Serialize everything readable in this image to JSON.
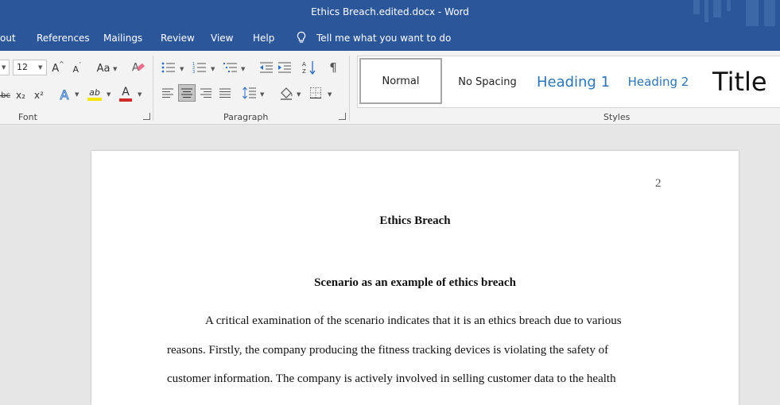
{
  "window": {
    "title": "Ethics Breach.edited.docx  -  Word"
  },
  "tabs": [
    {
      "label": "out"
    },
    {
      "label": "References"
    },
    {
      "label": "Mailings"
    },
    {
      "label": "Review"
    },
    {
      "label": "View"
    },
    {
      "label": "Help"
    }
  ],
  "tell_me": {
    "label": "Tell me what you want to do"
  },
  "font_group": {
    "label": "Font",
    "font_size": "12",
    "change_case": "Aa",
    "subscript": "x₂",
    "superscript": "x²",
    "strike": "abc",
    "grow": "A",
    "shrink": "A",
    "effects": "A",
    "highlight": "ab",
    "font_color": "A",
    "highlight_color": "#f5e70e",
    "font_color_bar": "#d22b2b"
  },
  "paragraph_group": {
    "label": "Paragraph",
    "pilcrow": "¶"
  },
  "styles_group": {
    "label": "Styles",
    "items": [
      {
        "label": "Normal"
      },
      {
        "label": "No Spacing"
      },
      {
        "label": "Heading 1"
      },
      {
        "label": "Heading 2"
      },
      {
        "label": "Title"
      }
    ],
    "heading_color": "#2e74b5"
  },
  "document": {
    "page_number": "2",
    "title": "Ethics Breach",
    "subtitle": "Scenario as an example of ethics breach",
    "lines": [
      "A critical examination of the scenario indicates that it is an ethics breach due to various",
      "reasons. Firstly, the company producing the fitness tracking devices is violating the safety of",
      "customer information. The company is actively involved in selling customer data to the health"
    ]
  }
}
